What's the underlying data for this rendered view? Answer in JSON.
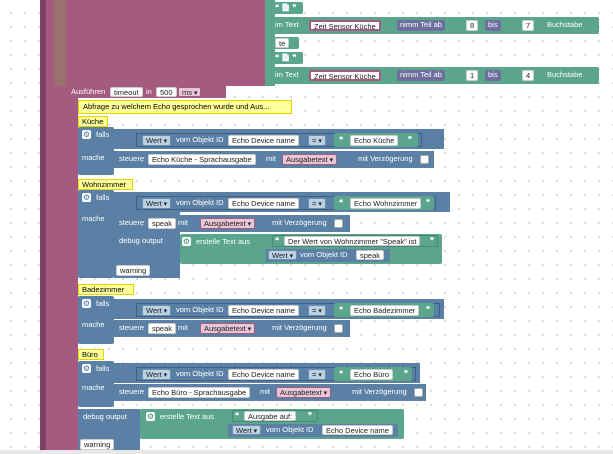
{
  "timeout_block": {
    "label": "Ausführen",
    "timeout": "timeout",
    "in": "in",
    "value": "500",
    "unit": "ms"
  },
  "comment": "Abfrage zu welchem Echo gesprochen wurde und Aus...",
  "top": {
    "quote1": "❝ 📄 ❞",
    "intext1": "im Text",
    "sensor1": "Zeit Sensor Küche",
    "teil1": "nimm Teil ab",
    "n1": "8",
    "bis1": "bis",
    "m1": "7",
    "bs1": "Buchstabe",
    "te": "te",
    "intext2": "im Text",
    "sensor2": "Zeit Sensor Küche",
    "teil2": "nimm Teil ab",
    "n2": "1",
    "bis2": "bis",
    "m2": "4",
    "bs2": "Buchstabe"
  },
  "common": {
    "falls": "falls",
    "mache": "mache",
    "wert": "Wert",
    "vom_objekt_id": "vom Objekt ID",
    "device": "Echo Device name",
    "eq": "=",
    "steuere": "steuere",
    "mit": "mit",
    "ausgabetext": "Ausgabetext",
    "verz": "mit Verzögerung",
    "speak": "speak",
    "debug": "debug output",
    "erstelle": "erstelle Text aus",
    "warning": "warning"
  },
  "rooms": [
    {
      "name": "Küche",
      "echo": "Echo Küche",
      "target": "Echo Küche - Sprachausgabe"
    },
    {
      "name": "Wohnzimmer",
      "echo": "Echo Wohnzimmer",
      "debug_text": "Der Wert von Wohnzimmer \"Speak\" ist"
    },
    {
      "name": "Badezimmer",
      "echo": "Echo Badezimmer"
    },
    {
      "name": "Büro",
      "echo": "Echo Büro",
      "target": "Echo Büro - Sprachausgabe",
      "debug_text": "Ausgabe auf: "
    }
  ],
  "colors": {
    "pink": "#a55b80",
    "blue": "#5b80a5",
    "green": "#5ba58c"
  }
}
